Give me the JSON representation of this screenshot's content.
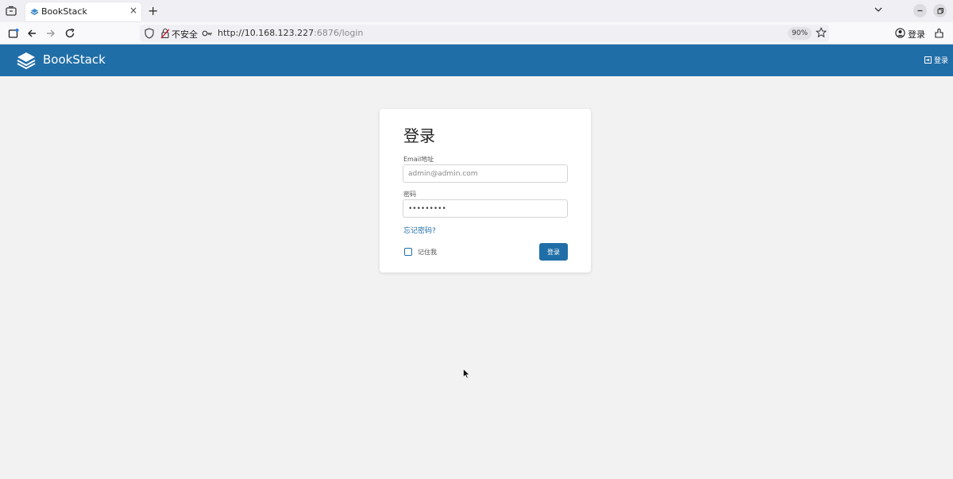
{
  "browser": {
    "tab": {
      "title": "BookStack",
      "close": "×"
    },
    "new_tab": "+",
    "url": {
      "security_label": "不安全",
      "host": "http://10.168.123.227",
      "path": ":6876/login"
    },
    "zoom": "90%",
    "sign_in": "登录"
  },
  "app": {
    "brand": "BookStack",
    "header_login": "登录",
    "accent_color": "#206ea7"
  },
  "login": {
    "title": "登录",
    "email_label": "Email地址",
    "email_placeholder": "admin@admin.com",
    "password_label": "密码",
    "password_value": "•••••••••",
    "forgot_link": "忘记密码?",
    "remember_label": "记住我",
    "submit_label": "登录"
  }
}
